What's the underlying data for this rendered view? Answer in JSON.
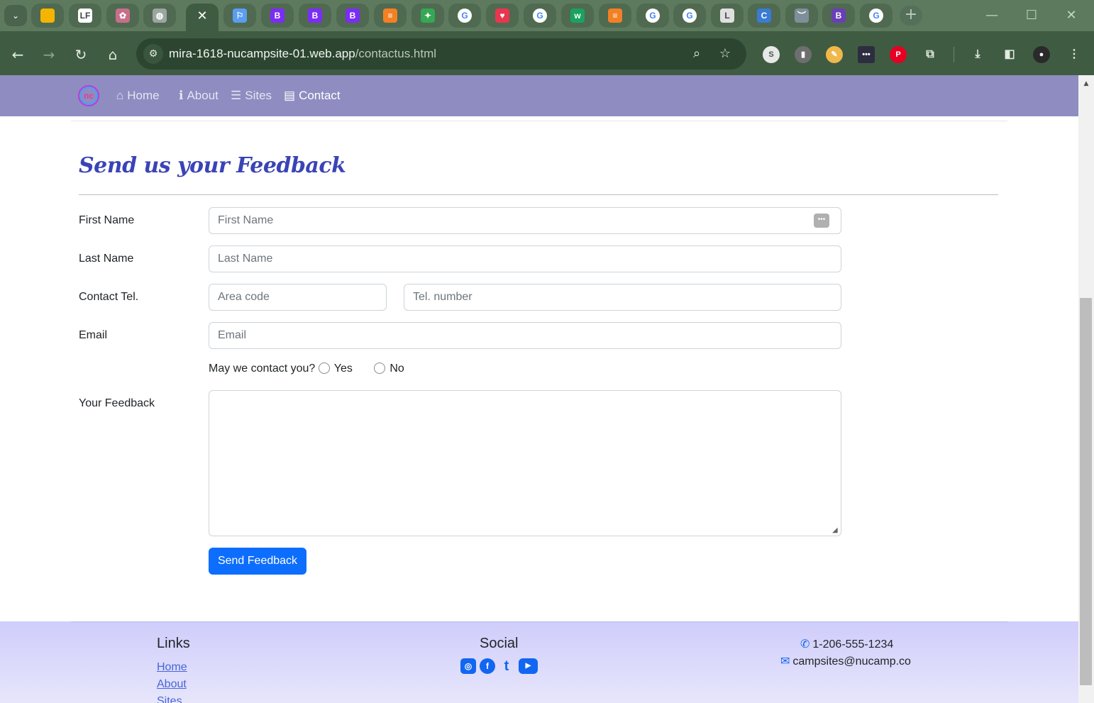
{
  "browser": {
    "tabs": [
      {
        "icon": "slides-icon",
        "fav": "",
        "color": "#f5b400"
      },
      {
        "icon": "lf-icon",
        "fav": "LF",
        "color": "#ffffff"
      },
      {
        "icon": "flower-icon",
        "fav": "✿",
        "color": "#c76f8a"
      },
      {
        "icon": "globe-icon",
        "fav": "◍",
        "color": "#9aa6a0"
      },
      {
        "icon": "close-icon",
        "fav": "✕",
        "color": "",
        "active": true
      },
      {
        "icon": "flag-icon",
        "fav": "⚐",
        "color": "#5b9df0"
      },
      {
        "icon": "bootstrap-icon",
        "fav": "B",
        "color": "#7b2cf5"
      },
      {
        "icon": "bootstrap-icon",
        "fav": "B",
        "color": "#7b2cf5"
      },
      {
        "icon": "bootstrap-icon",
        "fav": "B",
        "color": "#7b2cf5"
      },
      {
        "icon": "stackoverflow-icon",
        "fav": "≡",
        "color": "#f48024"
      },
      {
        "icon": "colorful-icon",
        "fav": "✦",
        "color": "#34a853"
      },
      {
        "icon": "google-icon",
        "fav": "G",
        "color": "#ffffff"
      },
      {
        "icon": "heart-icon",
        "fav": "♥",
        "color": "#e8364f"
      },
      {
        "icon": "google-icon",
        "fav": "G",
        "color": "#ffffff"
      },
      {
        "icon": "w-icon",
        "fav": "w",
        "color": "#1aa260"
      },
      {
        "icon": "stackoverflow-icon",
        "fav": "≡",
        "color": "#f48024"
      },
      {
        "icon": "google-icon",
        "fav": "G",
        "color": "#ffffff"
      },
      {
        "icon": "google-icon",
        "fav": "G",
        "color": "#ffffff"
      },
      {
        "icon": "l-icon",
        "fav": "L",
        "color": "#e0e0e0"
      },
      {
        "icon": "c-icon",
        "fav": "C",
        "color": "#3a7bd5"
      },
      {
        "icon": "chevron-icon",
        "fav": "︶",
        "color": "#7f8f9a"
      },
      {
        "icon": "bootstrap-icon",
        "fav": "B",
        "color": "#6a3fb5"
      },
      {
        "icon": "google-icon",
        "fav": "G",
        "color": "#ffffff"
      }
    ],
    "url_host": "mira-1618-nucampsite-01.web.app",
    "url_path": "/contactus.html"
  },
  "nav": {
    "brand": "nc",
    "links": [
      {
        "label": "Home",
        "icon": "⌂",
        "icon_name": "home-icon"
      },
      {
        "label": "About",
        "icon": "ℹ",
        "icon_name": "info-icon"
      },
      {
        "label": "Sites",
        "icon": "☰",
        "icon_name": "list-icon"
      },
      {
        "label": "Contact",
        "icon": "▤",
        "icon_name": "address-card-icon",
        "active": true
      }
    ]
  },
  "form": {
    "title": "Send us your Feedback",
    "first_name": {
      "label": "First Name",
      "placeholder": "First Name"
    },
    "last_name": {
      "label": "Last Name",
      "placeholder": "Last Name"
    },
    "tel": {
      "label": "Contact Tel.",
      "area_placeholder": "Area code",
      "number_placeholder": "Tel. number"
    },
    "email": {
      "label": "Email",
      "placeholder": "Email"
    },
    "contact_question": "May we contact you?",
    "radio_yes": "Yes",
    "radio_no": "No",
    "feedback_label": "Your Feedback",
    "submit": "Send Feedback"
  },
  "footer": {
    "links_heading": "Links",
    "links": [
      "Home",
      "About",
      "Sites"
    ],
    "social_heading": "Social",
    "social": [
      {
        "name": "instagram-icon",
        "glyph": "◎"
      },
      {
        "name": "facebook-icon",
        "glyph": "f"
      },
      {
        "name": "twitter-icon",
        "glyph": "t"
      },
      {
        "name": "youtube-icon",
        "glyph": "▶"
      }
    ],
    "phone": "1-206-555-1234",
    "email": "campsites@nucamp.co"
  },
  "colors": {
    "nav_bg": "#8e8cc0",
    "title": "#3a44b6",
    "primary": "#0d6efd",
    "footer_bg": "#cfcdfb"
  }
}
